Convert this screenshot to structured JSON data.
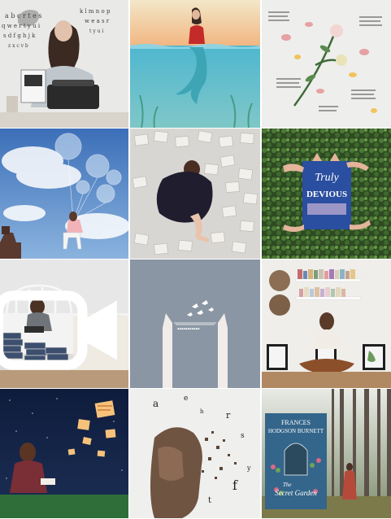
{
  "tiles": [
    {
      "caption": "",
      "scene": "woman-typewriter"
    },
    {
      "caption": "",
      "scene": "mermaid-underwater"
    },
    {
      "caption": "",
      "scene": "flatlay-roses"
    },
    {
      "caption": "",
      "scene": "woman-balloons-sky"
    },
    {
      "caption": "",
      "scene": "dress-on-book-pages"
    },
    {
      "caption": "",
      "scene": "hands-holding-book-ivy"
    },
    {
      "caption": "",
      "scene": "reading-on-bed",
      "video": true
    },
    {
      "caption": "",
      "scene": "hands-releasing-birds"
    },
    {
      "caption": "",
      "scene": "woman-floor-frames"
    },
    {
      "caption": "",
      "scene": "woman-night-books"
    },
    {
      "caption": "",
      "scene": "letters-dispersion"
    },
    {
      "caption": "",
      "scene": "secret-garden-forest"
    }
  ],
  "books": {
    "truly_devious": {
      "line1": "Truly",
      "line2": "DEVIOUS"
    },
    "secret_garden": {
      "author1": "FRANCES",
      "author2": "HODGSON BURNETT",
      "title_a": "The",
      "title_b": "Secret Garden"
    }
  },
  "colors": {
    "accent_blue": "#2a4ea0",
    "sky": "#5a88c8",
    "grass": "#3f7a3a"
  }
}
